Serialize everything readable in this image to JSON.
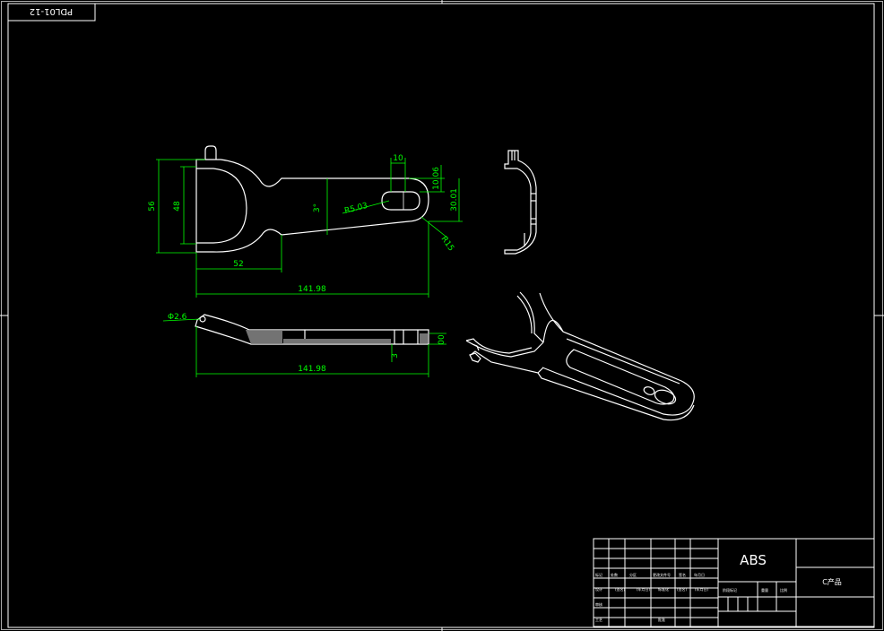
{
  "drawing_number": "PDL01-12",
  "dimensions": {
    "overall_height": "56",
    "inner_height": "48",
    "head_width": "52",
    "overall_length": "141.98",
    "slot_width": "10",
    "slot_offset": "10.06",
    "handle_width": "30.01",
    "slot_radius": "R5.03",
    "end_radius": "R15",
    "taper_angle": "3°",
    "hole_diameter": "Φ2.6",
    "side_length": "141.98",
    "thickness": "3",
    "end_thickness": "00"
  },
  "title_block": {
    "material": "ABS",
    "part_name": "C产品",
    "row_labels": [
      "标记",
      "处数",
      "分区",
      "更改文件号",
      "签名",
      "年月日"
    ],
    "row2_labels": [
      "设计",
      "(签名)",
      "(年月日)",
      "标准化",
      "(签名)",
      "(年月日)"
    ],
    "stage_label": "阶段标记",
    "weight_label": "重量",
    "scale_label": "比例",
    "review_label": "审核",
    "process_label": "工艺",
    "approve_label": "批准"
  },
  "colors": {
    "background": "#000000",
    "lines": "#ffffff",
    "dimensions": "#00ff00"
  }
}
